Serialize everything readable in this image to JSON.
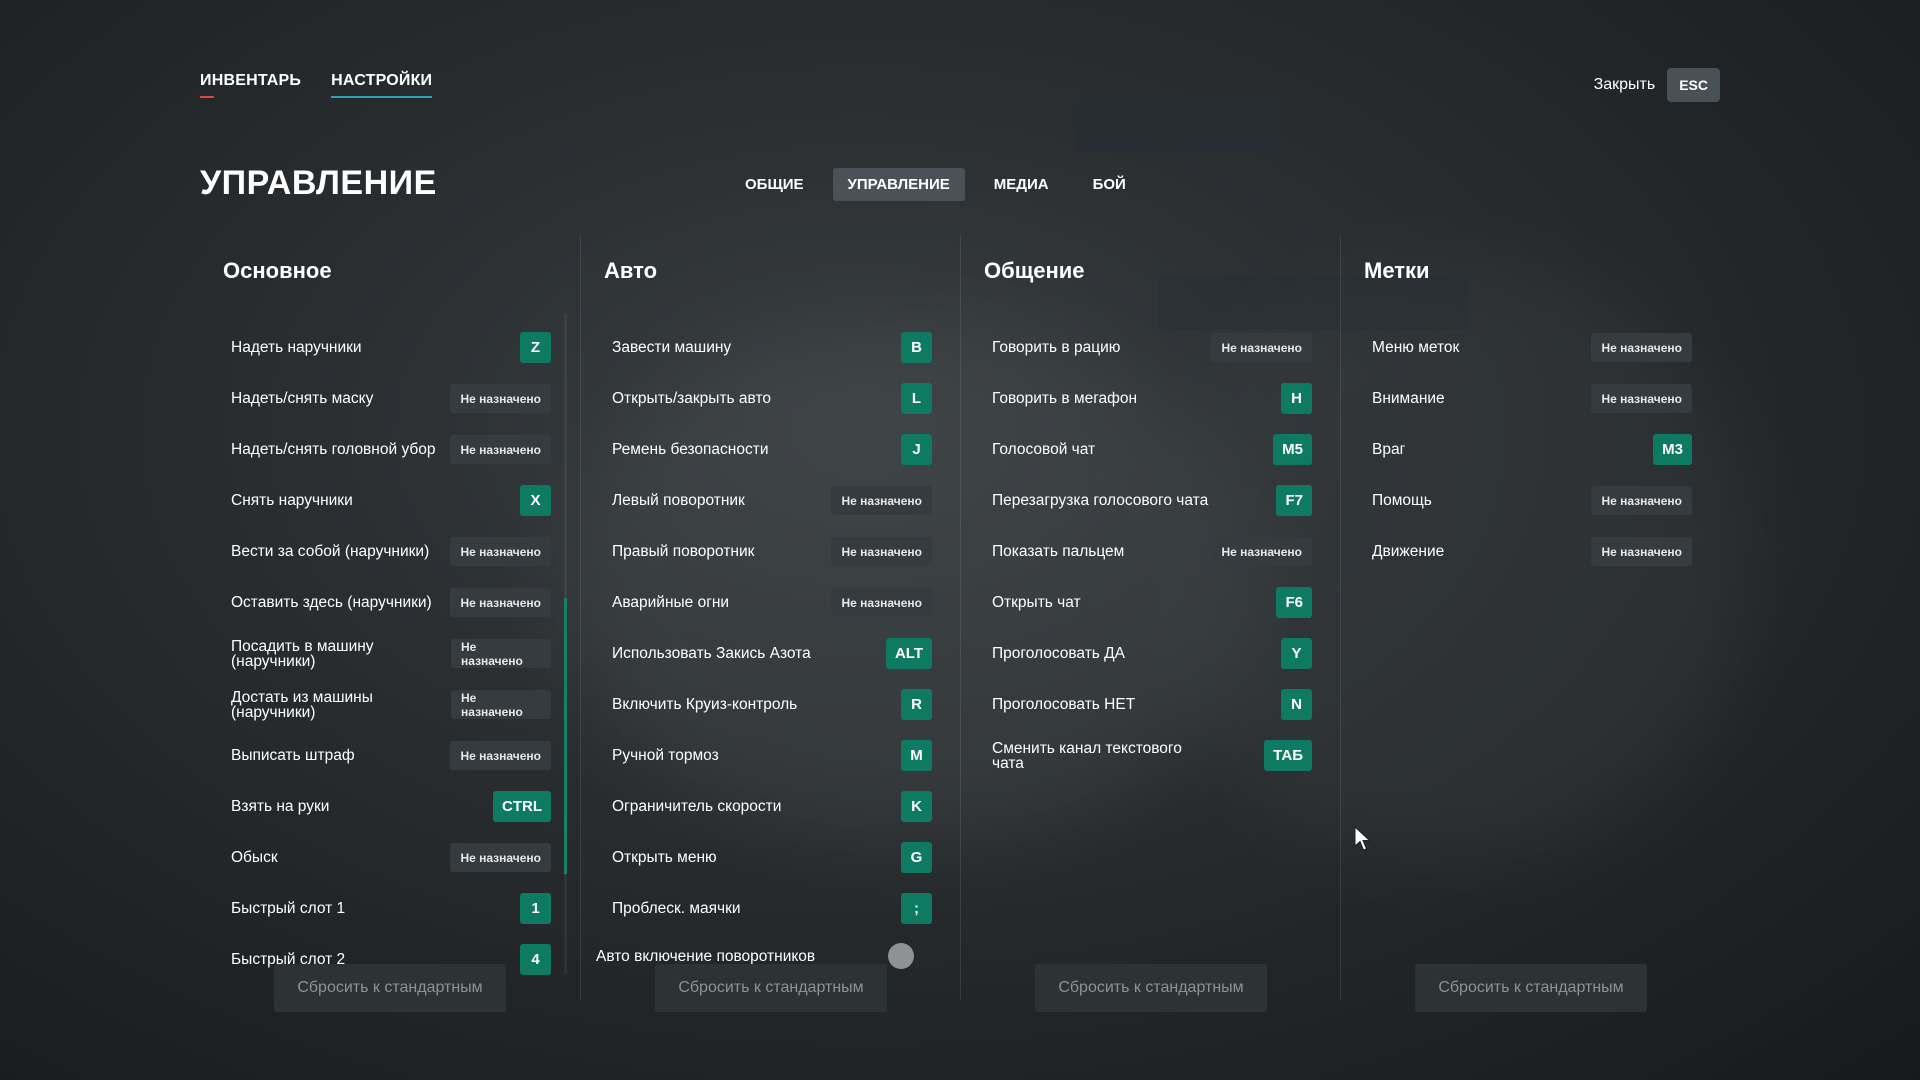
{
  "nav": {
    "inventory": "ИНВЕНТАРЬ",
    "settings": "НАСТРОЙКИ"
  },
  "close": {
    "label": "Закрыть",
    "key": "ESC"
  },
  "page_title": "УПРАВЛЕНИЕ",
  "subtabs": [
    "ОБЩИЕ",
    "УПРАВЛЕНИЕ",
    "МЕДИА",
    "БОЙ"
  ],
  "active_subtab": "УПРАВЛЕНИЕ",
  "colors": {
    "key_bg": "#0f7a62",
    "unset_bg": "#363b3f",
    "accent_red": "#e0463e",
    "accent_blue": "#2fa1b7"
  },
  "columns": [
    {
      "title": "Основное",
      "rows": [
        {
          "label": "Надеть наручники",
          "key": "Z"
        },
        {
          "label": "Надеть/снять маску",
          "key": "Не назначено"
        },
        {
          "label": "Надеть/снять головной убор",
          "key": "Не назначено"
        },
        {
          "label": "Снять наручники",
          "key": "X"
        },
        {
          "label": "Вести за собой (наручники)",
          "key": "Не назначено"
        },
        {
          "label": "Оставить здесь (наручники)",
          "key": "Не назначено"
        },
        {
          "label": "Посадить в машину (наручники)",
          "key": "Не назначено"
        },
        {
          "label": "Достать из машины (наручники)",
          "key": "Не назначено"
        },
        {
          "label": "Выписать штраф",
          "key": "Не назначено"
        },
        {
          "label": "Взять на руки",
          "key": "CTRL"
        },
        {
          "label": "Обыск",
          "key": "Не назначено"
        },
        {
          "label": "Быстрый слот 1",
          "key": "1"
        },
        {
          "label": "Быстрый слот 2",
          "key": "4"
        }
      ],
      "reset": "Сбросить к стандартным"
    },
    {
      "title": "Авто",
      "rows": [
        {
          "label": "Завести машину",
          "key": "B"
        },
        {
          "label": "Открыть/закрыть авто",
          "key": "L"
        },
        {
          "label": "Ремень безопасности",
          "key": "J"
        },
        {
          "label": "Левый поворотник",
          "key": "Не назначено"
        },
        {
          "label": "Правый поворотник",
          "key": "Не назначено"
        },
        {
          "label": "Аварийные огни",
          "key": "Не назначено"
        },
        {
          "label": "Использовать Закись Азота",
          "key": "ALT"
        },
        {
          "label": "Включить Круиз-контроль",
          "key": "R"
        },
        {
          "label": "Ручной тормоз",
          "key": "M"
        },
        {
          "label": "Ограничитель скорости",
          "key": "K"
        },
        {
          "label": "Открыть меню",
          "key": "G"
        },
        {
          "label": "Проблеск. маячки",
          "key": ";"
        }
      ],
      "toggle_label": "Авто включение поворотников",
      "reset": "Сбросить к стандартным"
    },
    {
      "title": "Общение",
      "rows": [
        {
          "label": "Говорить в рацию",
          "key": "Не назначено"
        },
        {
          "label": "Говорить в мегафон",
          "key": "H"
        },
        {
          "label": "Голосовой чат",
          "key": "M5"
        },
        {
          "label": "Перезагрузка голосового чата",
          "key": "F7"
        },
        {
          "label": "Показать пальцем",
          "key": "Не назначено"
        },
        {
          "label": "Открыть чат",
          "key": "F6"
        },
        {
          "label": "Проголосовать ДА",
          "key": "Y"
        },
        {
          "label": "Проголосовать НЕТ",
          "key": "N"
        },
        {
          "label": "Сменить канал текстового чата",
          "key": "ТАБ"
        }
      ],
      "reset": "Сбросить к стандартным"
    },
    {
      "title": "Метки",
      "rows": [
        {
          "label": "Меню меток",
          "key": "Не назначено"
        },
        {
          "label": "Внимание",
          "key": "Не назначено"
        },
        {
          "label": "Враг",
          "key": "M3"
        },
        {
          "label": "Помощь",
          "key": "Не назначено"
        },
        {
          "label": "Движение",
          "key": "Не назначено"
        }
      ],
      "reset": "Сбросить к стандартным"
    }
  ],
  "icons": {
    "cursor": "mouse-pointer-icon"
  }
}
